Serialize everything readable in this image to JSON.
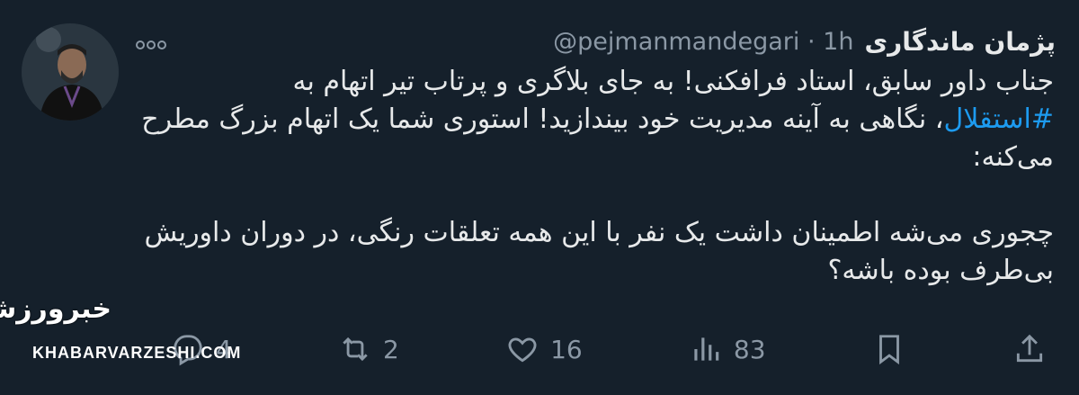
{
  "tweet": {
    "author": {
      "display_name": "پژمان ماندگاری",
      "handle": "@pejmanmandegari",
      "time": "1h",
      "avatar_icon": "profile-photo"
    },
    "separator": "·",
    "more_icon": "more-horizontal-icon",
    "body": {
      "line1": "جناب داور سابق، استاد فرافکنی! به جای بلاگری و پرتاب تیر اتهام به",
      "hashtag": "#استقلال",
      "line2_rest": "، نگاهی به آینه مدیریت خود بیندازید! استوری شما یک اتهام بزرگ مطرح می‌کنه:",
      "para2": "چجوری می‌شه اطمینان داشت یک نفر با این همه تعلقات رنگی، در دوران داوریش بی‌طرف بوده باشه؟"
    },
    "actions": {
      "reply_count": "4",
      "retweet_count": "2",
      "like_count": "16",
      "views_count": "83"
    }
  },
  "watermark": {
    "logo_text": "خبرورزشی",
    "site": "KHABARVARZESHI.COM"
  },
  "colors": {
    "background": "#15202b",
    "text": "#e7e9ea",
    "secondary": "#8b98a5",
    "link": "#1d9bf0"
  }
}
